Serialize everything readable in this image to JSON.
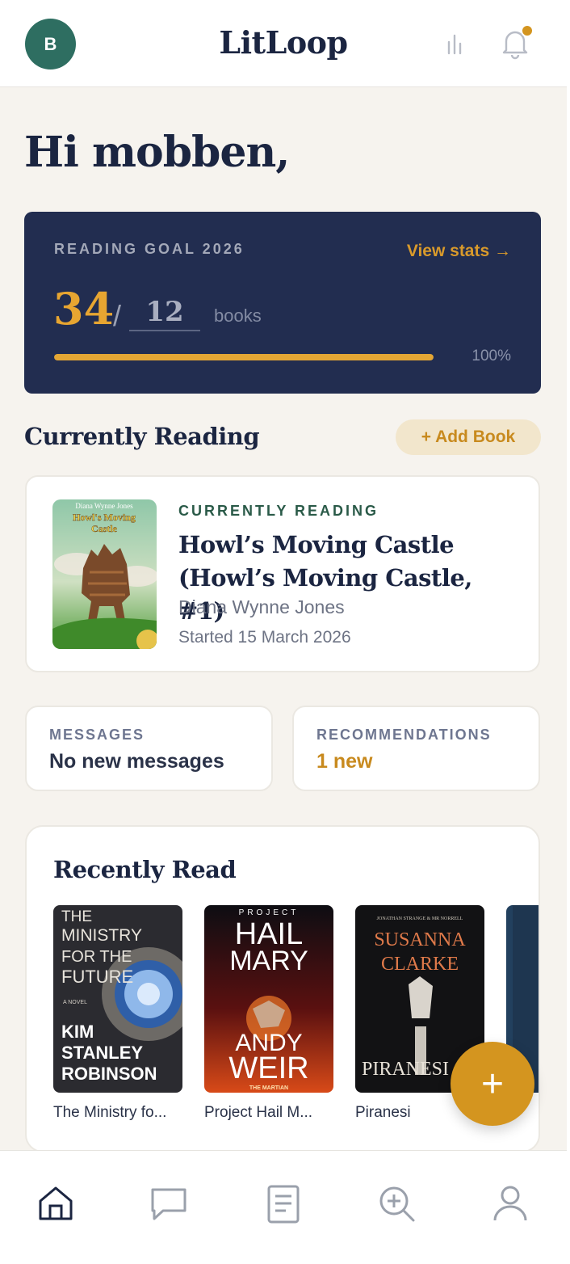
{
  "header": {
    "avatar_initial": "B",
    "app_title": "LitLoop",
    "has_notification": true,
    "accent_color": "#d4951f"
  },
  "greeting": "Hi mobben,",
  "goal": {
    "label": "READING GOAL 2026",
    "link": "View stats →",
    "count": "34",
    "slash": "/",
    "target": "12",
    "unit": "books",
    "progress_percent": 100,
    "percent_label": "100%"
  },
  "currently_reading_section": {
    "title": "Currently Reading",
    "add_button": "+ Add Book"
  },
  "current_book": {
    "kicker": "CURRENTLY READING",
    "title": "Howl’s Moving Castle (Howl’s Moving Castle, #1)",
    "author": "Diana Wynne Jones",
    "started": "Started 15 March 2026",
    "cover": {
      "author_line": "Diana Wynne Jones",
      "title_line1": "Howl's Moving",
      "title_line2": "Castle"
    }
  },
  "messages": {
    "label": "MESSAGES",
    "value": "No new messages"
  },
  "recommendations": {
    "label": "RECOMMENDATIONS",
    "value": "1 new"
  },
  "recently_read": {
    "title": "Recently Read",
    "books": [
      {
        "title": "The Ministry fo...",
        "cover": {
          "line1": "THE",
          "line2": "MINISTRY",
          "line3": "FOR THE",
          "line4": "FUTURE",
          "tag": "A NOVEL",
          "author1": "KIM",
          "author2": "STANLEY",
          "author3": "ROBINSON"
        }
      },
      {
        "title": "Project Hail M...",
        "cover": {
          "top": "PROJECT",
          "line1": "HAIL",
          "line2": "MARY",
          "author1": "ANDY",
          "author2": "WEIR",
          "footer": "THE MARTIAN"
        }
      },
      {
        "title": "Piranesi",
        "cover": {
          "top": "JONATHAN STRANGE & MR NORRELL",
          "author1": "SUSANNA",
          "author2": "CLARKE",
          "title": "PIRANESI"
        }
      }
    ]
  },
  "fab_label": "+",
  "bottom_nav": [
    "home-icon",
    "chat-icon",
    "book-icon",
    "search-plus-icon",
    "profile-icon"
  ]
}
